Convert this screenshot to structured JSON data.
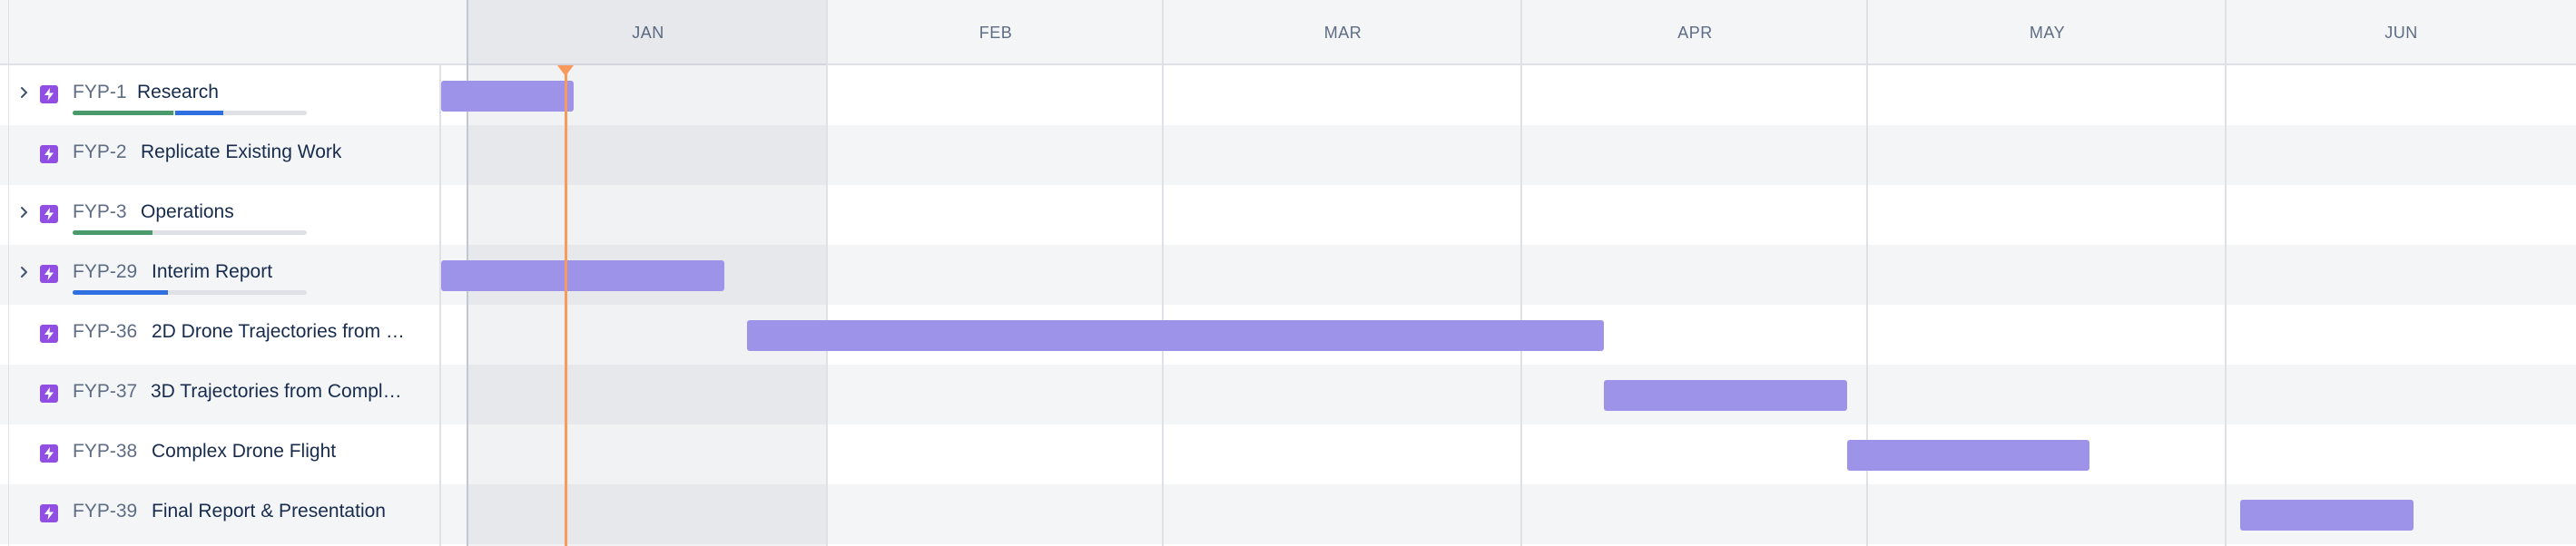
{
  "timeline": {
    "months": [
      "JAN",
      "FEB",
      "MAR",
      "APR",
      "MAY",
      "JUN"
    ]
  },
  "issues": [
    {
      "key": "FYP-1",
      "summary": "Research",
      "expandable": true,
      "progress": {
        "done": 0.43,
        "in_progress": 0.22
      }
    },
    {
      "key": "FYP-2",
      "summary": "Replicate Existing Work",
      "expandable": false
    },
    {
      "key": "FYP-3",
      "summary": "Operations",
      "expandable": true,
      "progress": {
        "done": 0.34,
        "in_progress": 0.0
      }
    },
    {
      "key": "FYP-29",
      "summary": "Interim Report",
      "expandable": true,
      "progress": {
        "done": 0.0,
        "in_progress": 0.41
      }
    },
    {
      "key": "FYP-36",
      "summary": "2D Drone Trajectories from …",
      "expandable": false
    },
    {
      "key": "FYP-37",
      "summary": "3D Trajectories from Compl…",
      "expandable": false
    },
    {
      "key": "FYP-38",
      "summary": "Complex Drone Flight",
      "expandable": false
    },
    {
      "key": "FYP-39",
      "summary": "Final Report & Presentation",
      "expandable": false
    }
  ],
  "colors": {
    "epic_icon": "#904ee2",
    "bar": "#9d93e8",
    "today_marker": "#f79a5b",
    "progress_done": "#4a9a6b",
    "progress_in_progress": "#2f6fe0"
  },
  "icons": {
    "expand": "chevron-right-icon",
    "issue_type": "epic-lightning-icon"
  }
}
